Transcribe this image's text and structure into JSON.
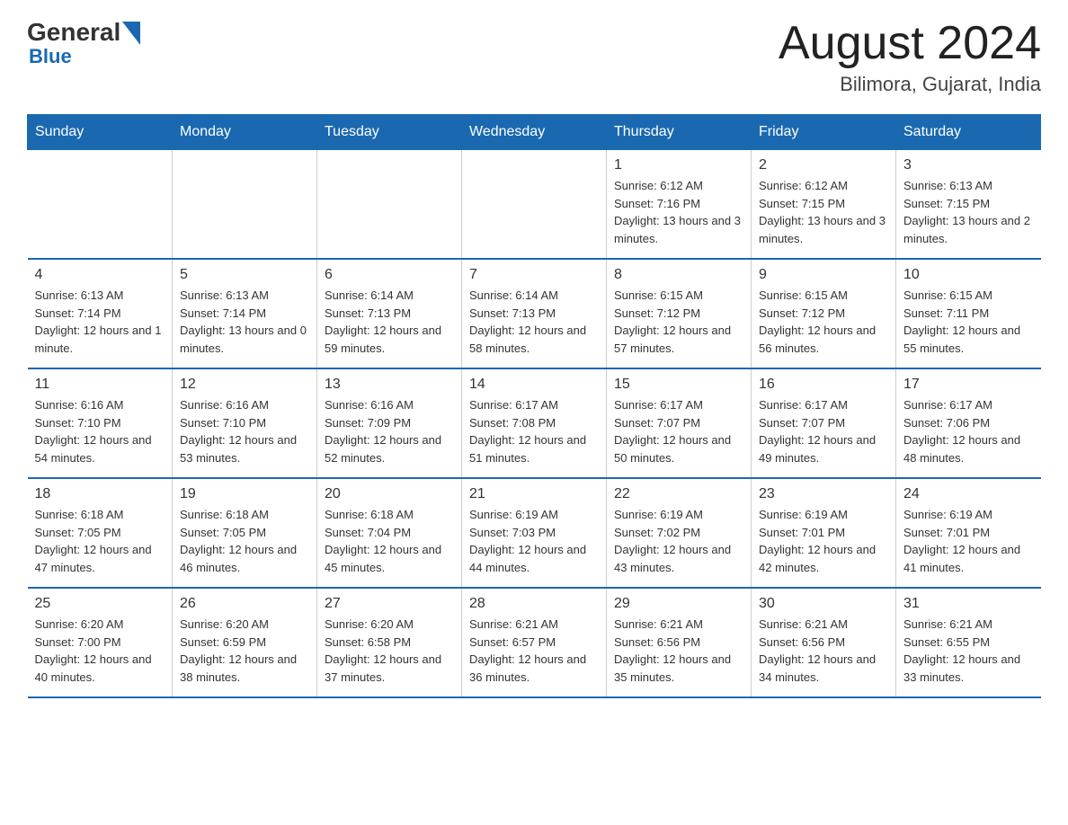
{
  "logo": {
    "general": "General",
    "blue": "Blue",
    "line2": "Blue"
  },
  "header": {
    "month": "August 2024",
    "location": "Bilimora, Gujarat, India"
  },
  "weekdays": [
    "Sunday",
    "Monday",
    "Tuesday",
    "Wednesday",
    "Thursday",
    "Friday",
    "Saturday"
  ],
  "weeks": [
    [
      {
        "day": "",
        "info": ""
      },
      {
        "day": "",
        "info": ""
      },
      {
        "day": "",
        "info": ""
      },
      {
        "day": "",
        "info": ""
      },
      {
        "day": "1",
        "info": "Sunrise: 6:12 AM\nSunset: 7:16 PM\nDaylight: 13 hours and 3 minutes."
      },
      {
        "day": "2",
        "info": "Sunrise: 6:12 AM\nSunset: 7:15 PM\nDaylight: 13 hours and 3 minutes."
      },
      {
        "day": "3",
        "info": "Sunrise: 6:13 AM\nSunset: 7:15 PM\nDaylight: 13 hours and 2 minutes."
      }
    ],
    [
      {
        "day": "4",
        "info": "Sunrise: 6:13 AM\nSunset: 7:14 PM\nDaylight: 12 hours and 1 minute."
      },
      {
        "day": "5",
        "info": "Sunrise: 6:13 AM\nSunset: 7:14 PM\nDaylight: 13 hours and 0 minutes."
      },
      {
        "day": "6",
        "info": "Sunrise: 6:14 AM\nSunset: 7:13 PM\nDaylight: 12 hours and 59 minutes."
      },
      {
        "day": "7",
        "info": "Sunrise: 6:14 AM\nSunset: 7:13 PM\nDaylight: 12 hours and 58 minutes."
      },
      {
        "day": "8",
        "info": "Sunrise: 6:15 AM\nSunset: 7:12 PM\nDaylight: 12 hours and 57 minutes."
      },
      {
        "day": "9",
        "info": "Sunrise: 6:15 AM\nSunset: 7:12 PM\nDaylight: 12 hours and 56 minutes."
      },
      {
        "day": "10",
        "info": "Sunrise: 6:15 AM\nSunset: 7:11 PM\nDaylight: 12 hours and 55 minutes."
      }
    ],
    [
      {
        "day": "11",
        "info": "Sunrise: 6:16 AM\nSunset: 7:10 PM\nDaylight: 12 hours and 54 minutes."
      },
      {
        "day": "12",
        "info": "Sunrise: 6:16 AM\nSunset: 7:10 PM\nDaylight: 12 hours and 53 minutes."
      },
      {
        "day": "13",
        "info": "Sunrise: 6:16 AM\nSunset: 7:09 PM\nDaylight: 12 hours and 52 minutes."
      },
      {
        "day": "14",
        "info": "Sunrise: 6:17 AM\nSunset: 7:08 PM\nDaylight: 12 hours and 51 minutes."
      },
      {
        "day": "15",
        "info": "Sunrise: 6:17 AM\nSunset: 7:07 PM\nDaylight: 12 hours and 50 minutes."
      },
      {
        "day": "16",
        "info": "Sunrise: 6:17 AM\nSunset: 7:07 PM\nDaylight: 12 hours and 49 minutes."
      },
      {
        "day": "17",
        "info": "Sunrise: 6:17 AM\nSunset: 7:06 PM\nDaylight: 12 hours and 48 minutes."
      }
    ],
    [
      {
        "day": "18",
        "info": "Sunrise: 6:18 AM\nSunset: 7:05 PM\nDaylight: 12 hours and 47 minutes."
      },
      {
        "day": "19",
        "info": "Sunrise: 6:18 AM\nSunset: 7:05 PM\nDaylight: 12 hours and 46 minutes."
      },
      {
        "day": "20",
        "info": "Sunrise: 6:18 AM\nSunset: 7:04 PM\nDaylight: 12 hours and 45 minutes."
      },
      {
        "day": "21",
        "info": "Sunrise: 6:19 AM\nSunset: 7:03 PM\nDaylight: 12 hours and 44 minutes."
      },
      {
        "day": "22",
        "info": "Sunrise: 6:19 AM\nSunset: 7:02 PM\nDaylight: 12 hours and 43 minutes."
      },
      {
        "day": "23",
        "info": "Sunrise: 6:19 AM\nSunset: 7:01 PM\nDaylight: 12 hours and 42 minutes."
      },
      {
        "day": "24",
        "info": "Sunrise: 6:19 AM\nSunset: 7:01 PM\nDaylight: 12 hours and 41 minutes."
      }
    ],
    [
      {
        "day": "25",
        "info": "Sunrise: 6:20 AM\nSunset: 7:00 PM\nDaylight: 12 hours and 40 minutes."
      },
      {
        "day": "26",
        "info": "Sunrise: 6:20 AM\nSunset: 6:59 PM\nDaylight: 12 hours and 38 minutes."
      },
      {
        "day": "27",
        "info": "Sunrise: 6:20 AM\nSunset: 6:58 PM\nDaylight: 12 hours and 37 minutes."
      },
      {
        "day": "28",
        "info": "Sunrise: 6:21 AM\nSunset: 6:57 PM\nDaylight: 12 hours and 36 minutes."
      },
      {
        "day": "29",
        "info": "Sunrise: 6:21 AM\nSunset: 6:56 PM\nDaylight: 12 hours and 35 minutes."
      },
      {
        "day": "30",
        "info": "Sunrise: 6:21 AM\nSunset: 6:56 PM\nDaylight: 12 hours and 34 minutes."
      },
      {
        "day": "31",
        "info": "Sunrise: 6:21 AM\nSunset: 6:55 PM\nDaylight: 12 hours and 33 minutes."
      }
    ]
  ]
}
